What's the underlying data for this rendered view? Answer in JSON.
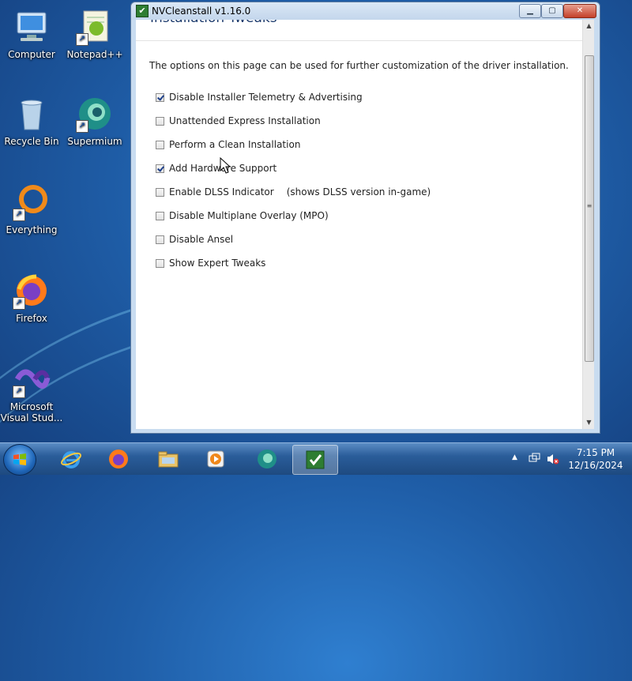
{
  "desktop": {
    "icons": [
      {
        "label": "Computer",
        "icon": "computer-icon"
      },
      {
        "label": "Notepad++",
        "icon": "notepadpp-icon"
      },
      {
        "label": "Recycle Bin",
        "icon": "recycle-bin-icon"
      },
      {
        "label": "Supermium",
        "icon": "supermium-icon"
      },
      {
        "label": "Everything",
        "icon": "everything-icon"
      },
      {
        "label": "Firefox",
        "icon": "firefox-icon"
      },
      {
        "label": "Microsoft Visual Stud...",
        "icon": "visual-studio-icon"
      }
    ]
  },
  "window": {
    "title": "NVCleanstall v1.16.0",
    "section_title": "Installation Tweaks",
    "intro": "The options on this page can be used for further customization of the driver installation.",
    "options": [
      {
        "label": "Disable Installer Telemetry & Advertising",
        "checked": true,
        "note": ""
      },
      {
        "label": "Unattended Express Installation",
        "checked": false,
        "note": ""
      },
      {
        "label": "Perform a Clean Installation",
        "checked": false,
        "note": ""
      },
      {
        "label": "Add Hardware Support",
        "checked": true,
        "note": ""
      },
      {
        "label": "Enable DLSS Indicator",
        "checked": false,
        "note": "(shows DLSS version in-game)"
      },
      {
        "label": "Disable Multiplane Overlay (MPO)",
        "checked": false,
        "note": ""
      },
      {
        "label": "Disable Ansel",
        "checked": false,
        "note": ""
      },
      {
        "label": "Show Expert Tweaks",
        "checked": false,
        "note": ""
      }
    ],
    "controls": {
      "minimize": "▁",
      "maximize": "▢",
      "close": "✕"
    }
  },
  "taskbar": {
    "items": [
      {
        "icon": "internet-explorer-icon"
      },
      {
        "icon": "firefox-icon"
      },
      {
        "icon": "file-explorer-icon"
      },
      {
        "icon": "media-player-icon"
      },
      {
        "icon": "supermium-icon"
      },
      {
        "icon": "nvcleanstall-icon",
        "active": true
      }
    ],
    "clock": {
      "time": "7:15 PM",
      "date": "12/16/2024"
    },
    "tray": {
      "show_hidden": "▲"
    }
  },
  "colors": {
    "accent": "#1e3c6e",
    "checkmark": "#1d3f8a"
  }
}
